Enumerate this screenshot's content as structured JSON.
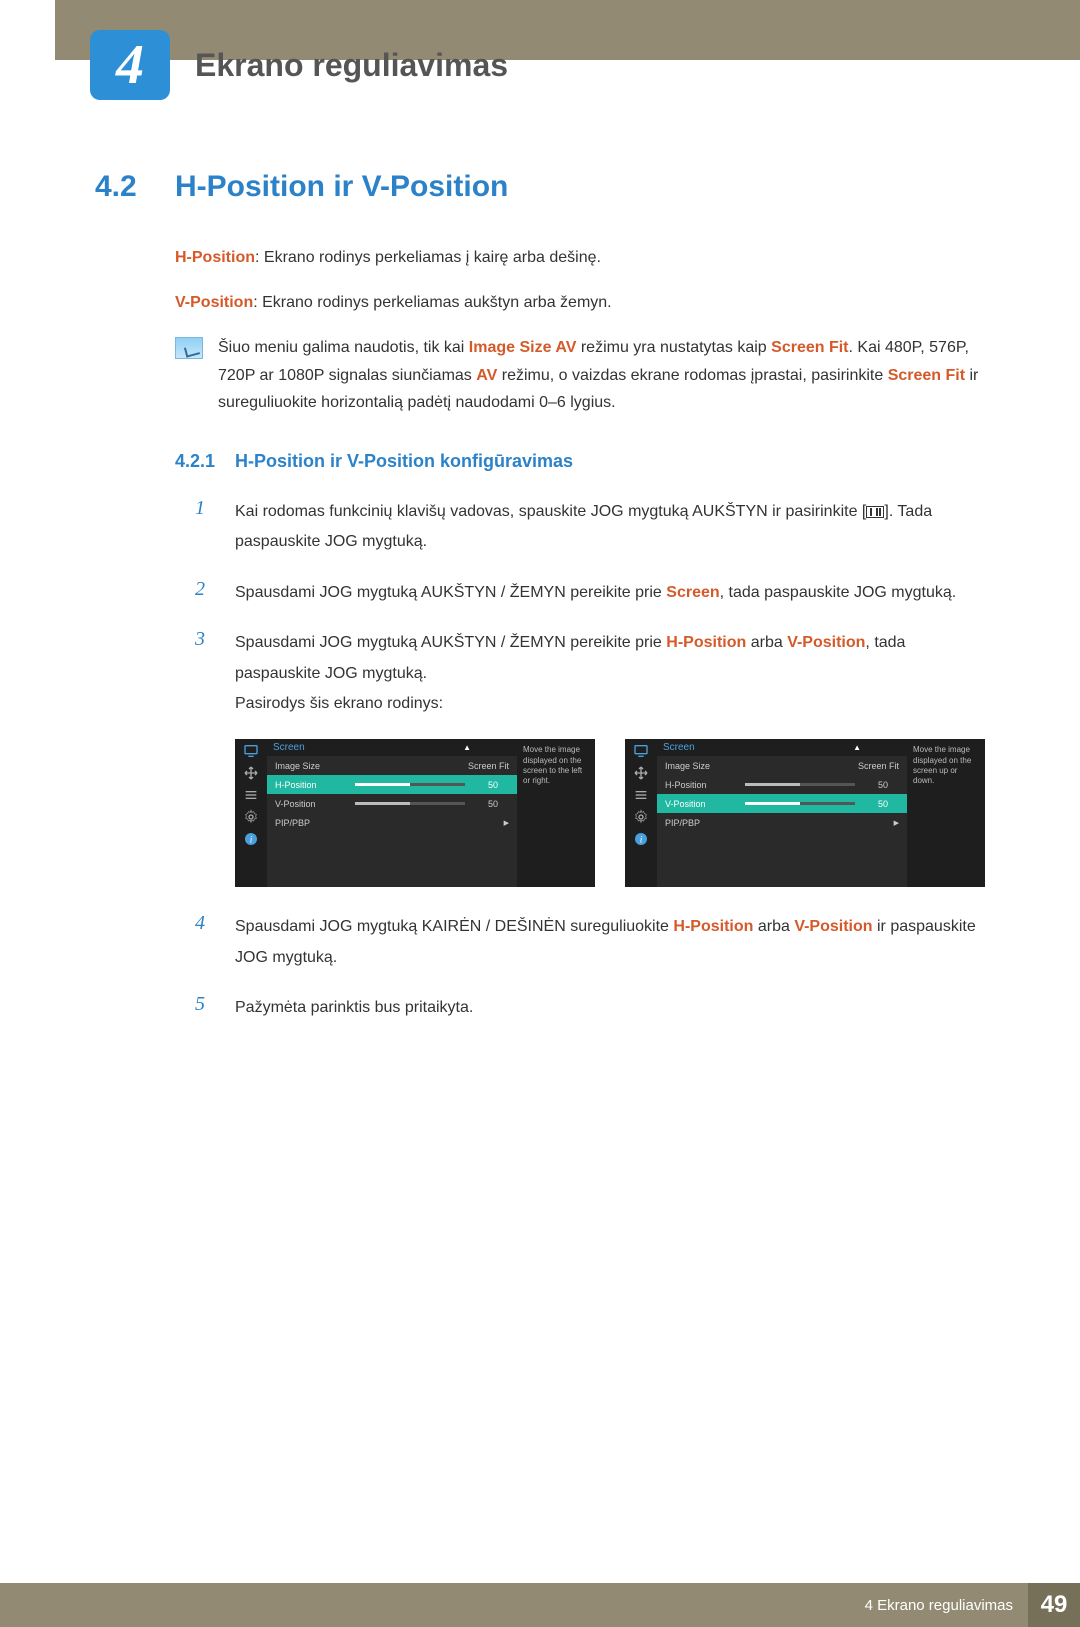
{
  "header": {
    "chapter_number": "4",
    "chapter_title": "Ekrano reguliavimas"
  },
  "section": {
    "number": "4.2",
    "title": "H-Position ir V-Position"
  },
  "descriptions": {
    "h_label": "H-Position",
    "h_text": ": Ekrano rodinys perkeliamas į kairę arba dešinę.",
    "v_label": "V-Position",
    "v_text": ": Ekrano rodinys perkeliamas aukštyn arba žemyn."
  },
  "note": {
    "t1": "Šiuo meniu galima naudotis, tik kai ",
    "e1": "Image Size AV",
    "t2": " režimu yra nustatytas kaip ",
    "e2": "Screen Fit",
    "t3": ". Kai 480P, 576P, 720P ar 1080P signalas siunčiamas ",
    "e3": "AV",
    "t4": " režimu, o vaizdas ekrane rodomas įprastai, pasirinkite ",
    "e4": "Screen Fit",
    "t5": " ir sureguliuokite horizontalią padėtį naudodami 0–6 lygius."
  },
  "subsection": {
    "number": "4.2.1",
    "title": "H-Position ir V-Position konfigūravimas"
  },
  "steps": {
    "s1n": "1",
    "s1a": "Kai rodomas funkcinių klavišų vadovas, spauskite JOG mygtuką AUKŠTYN ir pasirinkite [",
    "s1b": "]. Tada paspauskite JOG mygtuką.",
    "s2n": "2",
    "s2a": "Spausdami JOG mygtuką AUKŠTYN / ŽEMYN pereikite prie ",
    "s2e": "Screen",
    "s2b": ", tada paspauskite JOG mygtuką.",
    "s3n": "3",
    "s3a": "Spausdami JOG mygtuką AUKŠTYN / ŽEMYN pereikite prie ",
    "s3e1": "H-Position",
    "s3m": " arba ",
    "s3e2": "V-Position",
    "s3b": ", tada paspauskite JOG mygtuką.",
    "s3c": "Pasirodys šis ekrano rodinys:",
    "s4n": "4",
    "s4a": "Spausdami JOG mygtuką KAIRĖN / DEŠINĖN sureguliuokite ",
    "s4e1": "H-Position",
    "s4m": " arba ",
    "s4e2": "V-Position",
    "s4b": " ir paspauskite JOG mygtuką.",
    "s5n": "5",
    "s5a": "Pažymėta parinktis bus pritaikyta."
  },
  "osd": {
    "title": "Screen",
    "row_imgsize": "Image Size",
    "row_imgsize_val": "Screen Fit",
    "row_hpos": "H-Position",
    "row_vpos": "V-Position",
    "row_pip": "PIP/PBP",
    "val50": "50",
    "help_left": "Move the image displayed on the screen to the left or right.",
    "help_right": "Move the image displayed on the screen up or down."
  },
  "footer": {
    "text": "4 Ekrano reguliavimas",
    "page": "49"
  }
}
